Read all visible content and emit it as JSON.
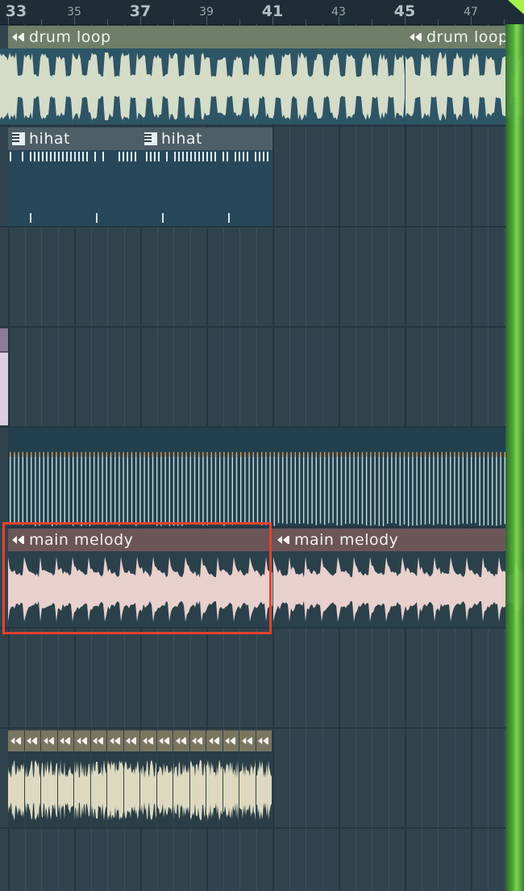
{
  "ruler": {
    "bars": [
      {
        "label": "33",
        "major": true
      },
      {
        "label": "35",
        "major": false
      },
      {
        "label": "37",
        "major": true
      },
      {
        "label": "39",
        "major": false
      },
      {
        "label": "41",
        "major": true
      },
      {
        "label": "43",
        "major": false
      },
      {
        "label": "45",
        "major": true
      },
      {
        "label": "47",
        "major": false
      }
    ]
  },
  "clips": {
    "drum_loop_1": {
      "name": "drum loop",
      "icon": "audio-clip-icon"
    },
    "drum_loop_2": {
      "name": "drum loop",
      "icon": "audio-clip-icon"
    },
    "hihat_1": {
      "name": "hihat",
      "icon": "piano-roll-icon"
    },
    "hihat_2": {
      "name": "hihat",
      "icon": "piano-roll-icon"
    },
    "main_melody_1": {
      "name": "main melody",
      "icon": "audio-clip-icon",
      "selected": true
    },
    "main_melody_2": {
      "name": "main melody",
      "icon": "audio-clip-icon"
    },
    "chop_clips_count": 16
  },
  "colors": {
    "drum_loop": "#d4dcc8",
    "hihat": "#a9c4d4",
    "melody": "#e8d0cc",
    "chops": "#ddd8bf",
    "selection": "#e8412a",
    "playhead": "#7ee04e"
  }
}
